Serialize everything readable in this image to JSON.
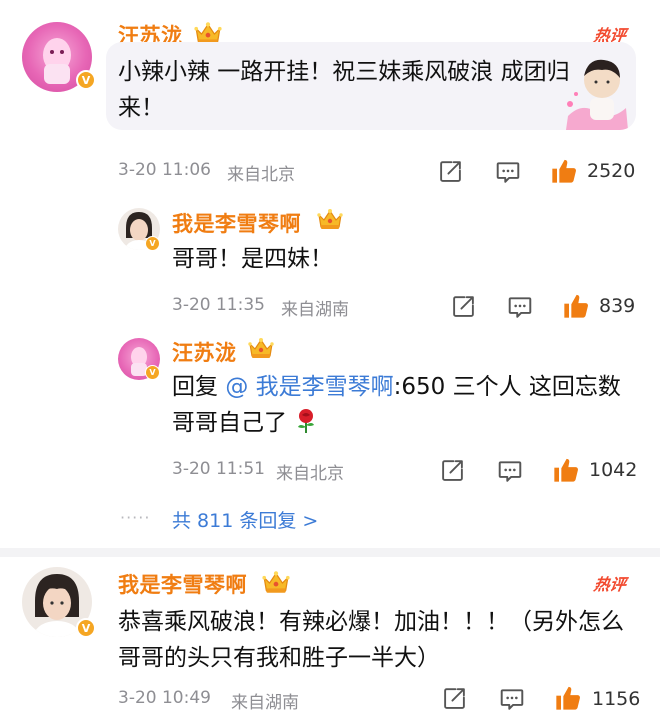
{
  "comments": [
    {
      "user": "汪苏泷",
      "hot_label": "热评",
      "text": "小辣小辣 一路开挂！祝三妹乘风破浪 成团归来！",
      "time": "3-20 11:06",
      "location": "来自北京",
      "likes": "2520",
      "replies": [
        {
          "user": "我是李雪琴啊",
          "text": "哥哥！是四妹！",
          "time": "3-20 11:35",
          "location": "来自湖南",
          "likes": "839"
        },
        {
          "user": "汪苏泷",
          "reply_prefix": "回复",
          "mention": "@ 我是李雪琴啊",
          "text": ":650 三个人 这回忘数哥哥自己了",
          "time": "3-20 11:51",
          "location": "来自北京",
          "likes": "1042"
        }
      ],
      "more_replies": "共 811 条回复 >"
    },
    {
      "user": "我是李雪琴啊",
      "hot_label": "热评",
      "text": "恭喜乘风破浪！有辣必爆！加油！！！（另外怎么哥哥的头只有我和胜子一半大）",
      "time": "3-20 10:49",
      "location": "来自湖南",
      "likes": "1156"
    }
  ],
  "colors": {
    "username": "#f07d12",
    "link": "#3c7bd6",
    "hot": "#f24a2f",
    "meta": "#8e8e93",
    "like_icon": "#f07d12",
    "bubble_bg": "#f4f3f8"
  },
  "icons": {
    "share": "share-icon",
    "comment": "comment-icon",
    "like": "like-icon",
    "crown": "crown-icon",
    "verified": "verified-icon",
    "rose": "rose-emoji-icon"
  }
}
